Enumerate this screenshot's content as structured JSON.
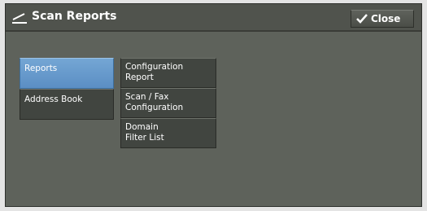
{
  "header": {
    "title": "Scan Reports",
    "title_icon": "scan-edit-icon",
    "close_label": "Close",
    "close_icon": "checkmark-icon"
  },
  "left_menu": [
    {
      "label": "Reports",
      "selected": true
    },
    {
      "label": "Address Book",
      "selected": false
    }
  ],
  "report_items": [
    {
      "line1": "Configuration",
      "line2": "Report"
    },
    {
      "line1": "Scan / Fax",
      "line2": "Configuration"
    },
    {
      "line1": "Domain",
      "line2": "Filter List"
    }
  ],
  "colors": {
    "selected": "#6a9fd0",
    "button": "#414540",
    "panel": "#5e625b"
  }
}
